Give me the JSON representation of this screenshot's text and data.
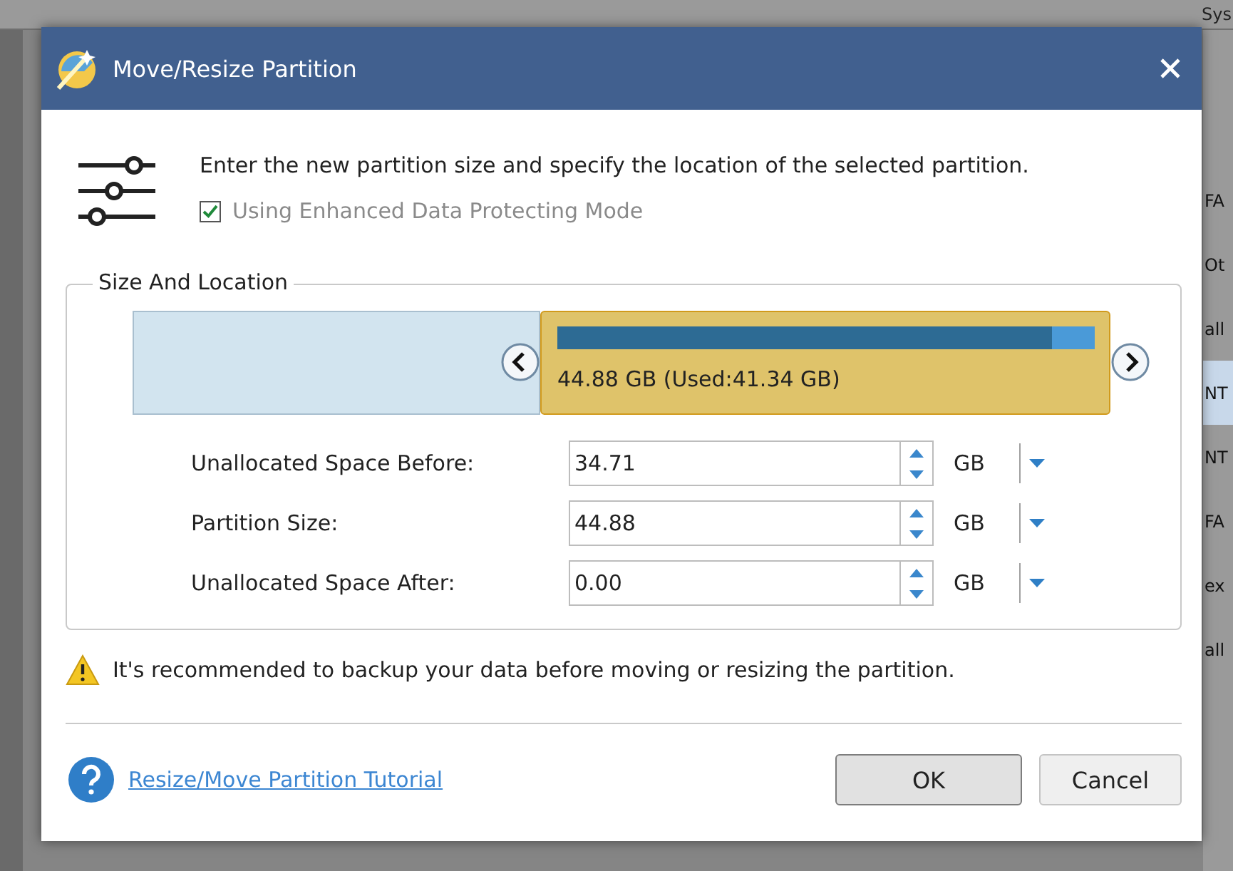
{
  "background": {
    "header_text": "Sys",
    "column_texts": [
      {
        "text": "FA",
        "selected": false
      },
      {
        "text": "Ot",
        "selected": false
      },
      {
        "text": "all",
        "selected": false
      },
      {
        "text": "NT",
        "selected": true
      },
      {
        "text": "NT",
        "selected": false
      },
      {
        "text": "FA",
        "selected": false
      },
      {
        "text": "ex",
        "selected": false
      },
      {
        "text": "all",
        "selected": false
      }
    ]
  },
  "dialog": {
    "title": "Move/Resize Partition",
    "intro": "Enter the new partition size and specify the location of the selected partition.",
    "protect_mode": {
      "label": "Using Enhanced Data Protecting Mode",
      "checked": true
    },
    "group_title": "Size And Location",
    "partition": {
      "label": "44.88 GB (Used:41.34 GB)",
      "level": 0.92
    },
    "fields": [
      {
        "label": "Unallocated Space Before:",
        "value": "34.71",
        "unit": "GB"
      },
      {
        "label": "Partition Size:",
        "value": "44.88",
        "unit": "GB"
      },
      {
        "label": "Unallocated Space After:",
        "value": "0.00",
        "unit": "GB"
      }
    ],
    "warning": "It's recommended to backup your data before moving or resizing the partition.",
    "tutorial_link": "Resize/Move Partition Tutorial",
    "buttons": [
      {
        "label": "OK",
        "kind": "default"
      },
      {
        "label": "Cancel",
        "kind": "normal"
      }
    ]
  }
}
